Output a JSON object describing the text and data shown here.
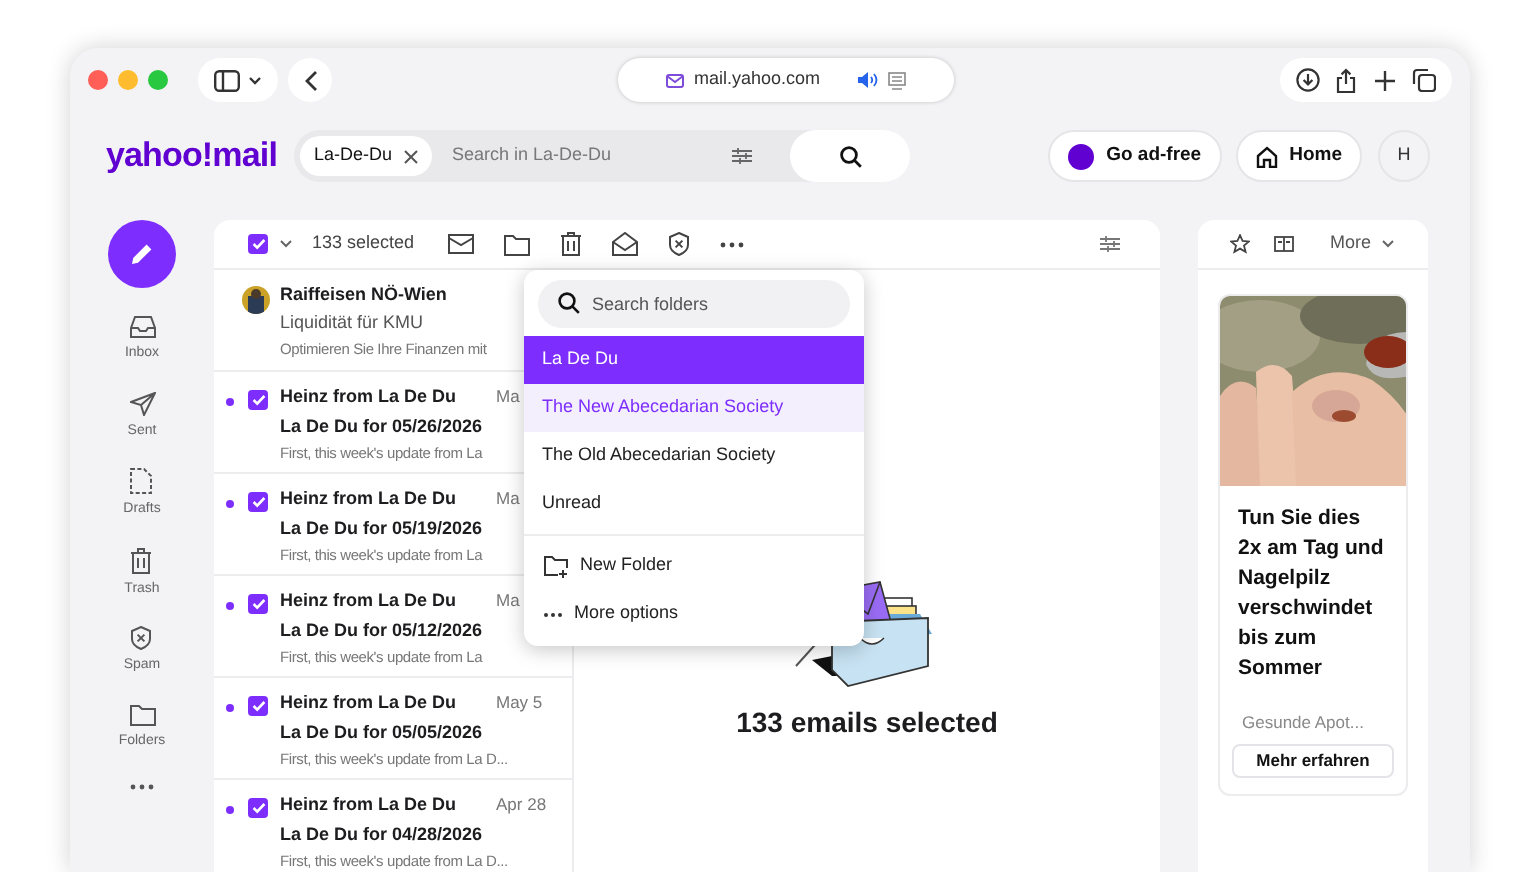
{
  "browser": {
    "url": "mail.yahoo.com"
  },
  "header": {
    "logo": "yahoo!mail",
    "search_chip": "La-De-Du",
    "search_placeholder": "Search in La-De-Du",
    "buttons": [
      {
        "kind": "adfree",
        "label": "Go ad-free"
      },
      {
        "kind": "home",
        "label": "Home"
      }
    ],
    "avatar": "H"
  },
  "nav": [
    {
      "kind": "inbox",
      "label": "Inbox"
    },
    {
      "kind": "sent",
      "label": "Sent"
    },
    {
      "kind": "drafts",
      "label": "Drafts"
    },
    {
      "kind": "trash",
      "label": "Trash"
    },
    {
      "kind": "spam",
      "label": "Spam"
    },
    {
      "kind": "folders",
      "label": "Folders"
    }
  ],
  "toolbar": {
    "select_all_checked": true,
    "selected_count": "133 selected"
  },
  "messages": [
    {
      "kind": "ad",
      "sender": "Raiffeisen NÖ-Wien",
      "subject": "Liquidität für KMU",
      "preview": "Optimieren Sie Ihre Finanzen mit"
    },
    {
      "kind": "email",
      "unread": true,
      "checked": true,
      "sender": "Heinz from La De Du",
      "date": "Ma",
      "subject": "La De Du for 05/26/2026",
      "preview": "First, this week's update from La"
    },
    {
      "kind": "email",
      "unread": true,
      "checked": true,
      "sender": "Heinz from La De Du",
      "date": "Ma",
      "subject": "La De Du for 05/19/2026",
      "preview": "First, this week's update from La"
    },
    {
      "kind": "email",
      "unread": true,
      "checked": true,
      "sender": "Heinz from La De Du",
      "date": "Ma",
      "subject": "La De Du for 05/12/2026",
      "preview": "First, this week's update from La"
    },
    {
      "kind": "email",
      "unread": true,
      "checked": true,
      "sender": "Heinz from La De Du",
      "date": "May 5",
      "subject": "La De Du for 05/05/2026",
      "preview": "First, this week's update from La D..."
    },
    {
      "kind": "email",
      "unread": true,
      "checked": true,
      "sender": "Heinz from La De Du",
      "date": "Apr 28",
      "subject": "La De Du for 04/28/2026",
      "preview": "First, this week's update from La D..."
    }
  ],
  "folder_menu": {
    "placeholder": "Search folders",
    "folders": [
      {
        "label": "La De Du",
        "selected": true
      },
      {
        "label": "The New Abecedarian Society",
        "selected": false,
        "hovered": true
      },
      {
        "label": "The Old Abecedarian Society",
        "selected": false
      },
      {
        "label": "Unread",
        "selected": false
      }
    ],
    "actions": [
      {
        "kind": "new-folder",
        "label": "New Folder"
      },
      {
        "kind": "more",
        "label": "More options"
      }
    ]
  },
  "selection_summary": "133 emails selected",
  "side_panel": {
    "more": "More",
    "ad": {
      "headline": "Tun Sie dies 2x am Tag und Nagelpilz verschwindet bis zum Sommer",
      "advertiser": "Gesunde Apot...",
      "button": "Mehr erfahren"
    }
  }
}
